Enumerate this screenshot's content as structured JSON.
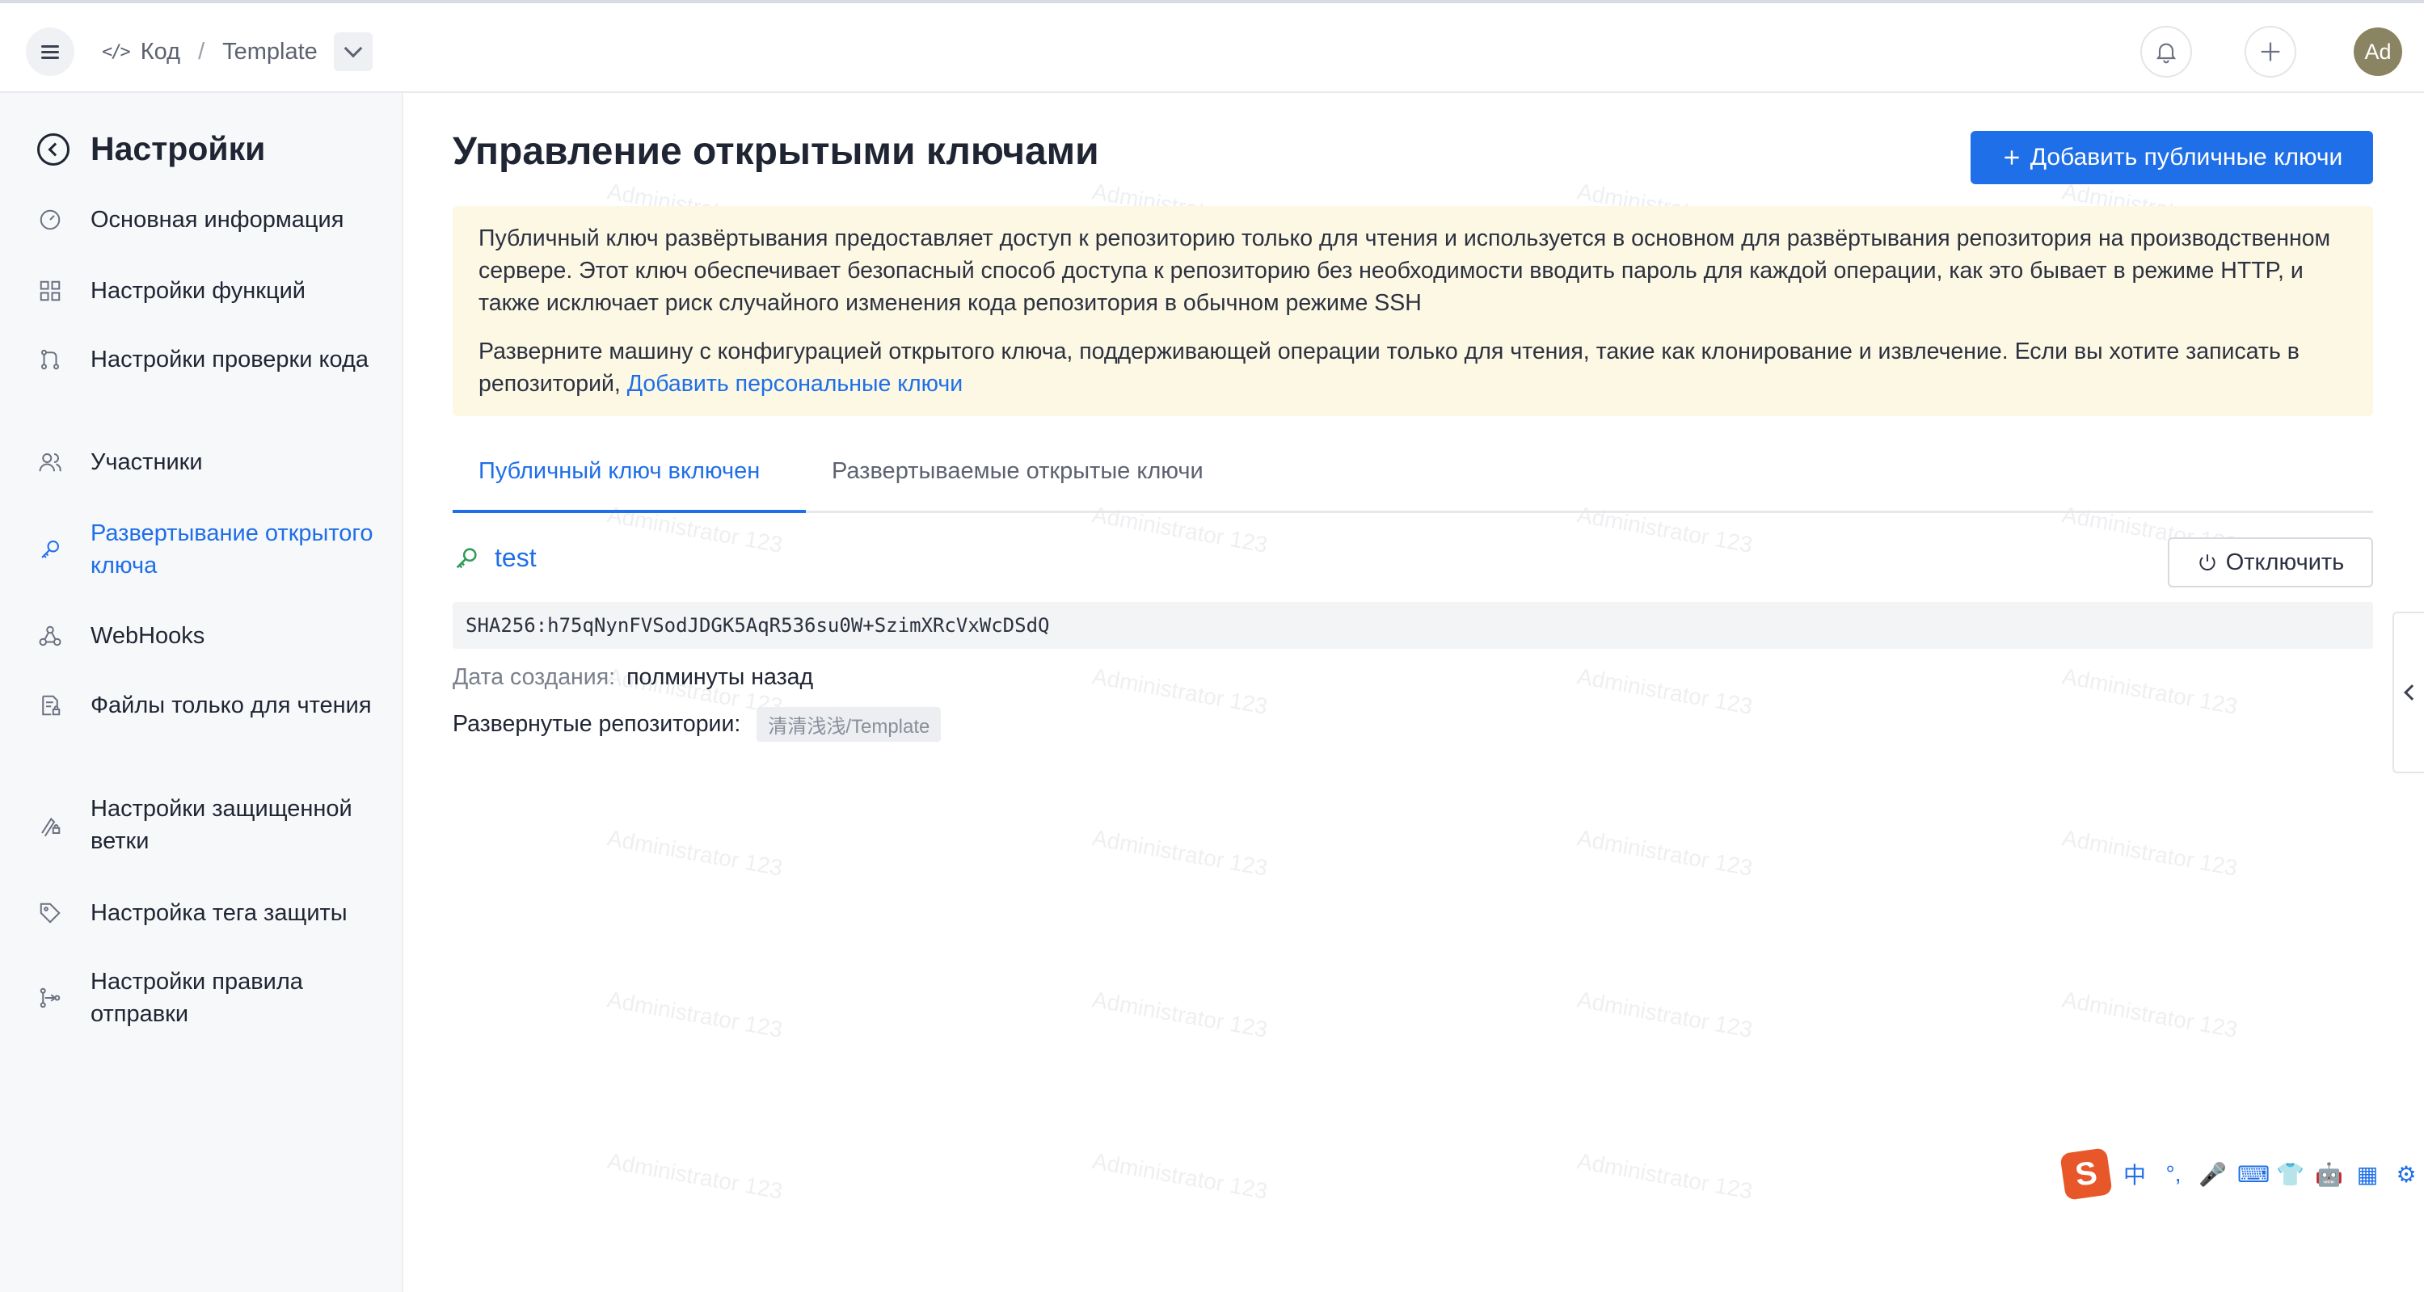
{
  "topbar": {
    "breadcrumb": {
      "section": "Код",
      "separator": "/",
      "repo": "Template"
    },
    "avatar_initials": "Ad"
  },
  "sidebar": {
    "title": "Настройки",
    "items": [
      {
        "label": "Основная информация",
        "icon": "dashboard-icon"
      },
      {
        "label": "Настройки функций",
        "icon": "grid-icon"
      },
      {
        "label": "Настройки проверки кода",
        "icon": "merge-icon"
      },
      {
        "label": "Участники",
        "icon": "users-icon"
      },
      {
        "label": "Развертывание открытого ключа",
        "icon": "key-icon",
        "active": true
      },
      {
        "label": "WebHooks",
        "icon": "webhook-icon"
      },
      {
        "label": "Файлы только для чтения",
        "icon": "file-lock-icon"
      },
      {
        "label": "Настройки защищенной ветки",
        "icon": "branch-lock-icon"
      },
      {
        "label": "Настройка тега защиты",
        "icon": "tag-icon"
      },
      {
        "label": "Настройки правила отправки",
        "icon": "push-rule-icon"
      }
    ]
  },
  "main": {
    "title": "Управление открытыми ключами",
    "add_button_label": "Добавить публичные ключи",
    "notice": {
      "paragraph1": "Публичный ключ развёртывания предоставляет доступ к репозиторию только для чтения и используется в основном для развёртывания репозитория на производственном сервере. Этот ключ обеспечивает безопасный способ доступа к репозиторию без необходимости вводить пароль для каждой операции, как это бывает в режиме HTTP, и также исключает риск случайного изменения кода репозитория в обычном режиме SSH",
      "paragraph2": "Разверните машину с конфигурацией открытого ключа, поддерживающей операции только для чтения, такие как клонирование и извлечение. Если вы хотите записать в репозиторий,",
      "link": "Добавить персональные ключи"
    },
    "tabs": [
      {
        "label": "Публичный ключ включен",
        "active": true
      },
      {
        "label": "Развертываемые открытые ключи",
        "active": false
      }
    ],
    "key": {
      "name": "test",
      "disable_label": "Отключить",
      "fingerprint": "SHA256:h75qNynFVSodJDGK5AqR536su0W+SzimXRcVxWcDSdQ",
      "created_label": "Дата создания:",
      "created_value": "полминуты назад",
      "repos_label": "Развернутые репозитории:",
      "repo_tag": "清清浅浅/Template"
    }
  },
  "ime": {
    "logo": "S",
    "glyphs": [
      "中",
      "°,",
      "🎤",
      "⌨",
      "👕",
      "🤖",
      "▦",
      "⚙"
    ]
  },
  "watermark_text": "Administrator 123",
  "colors": {
    "accent": "#1f6fe8",
    "notice_bg": "#fdf8e4",
    "sidebar_bg": "#f7f8fa"
  }
}
